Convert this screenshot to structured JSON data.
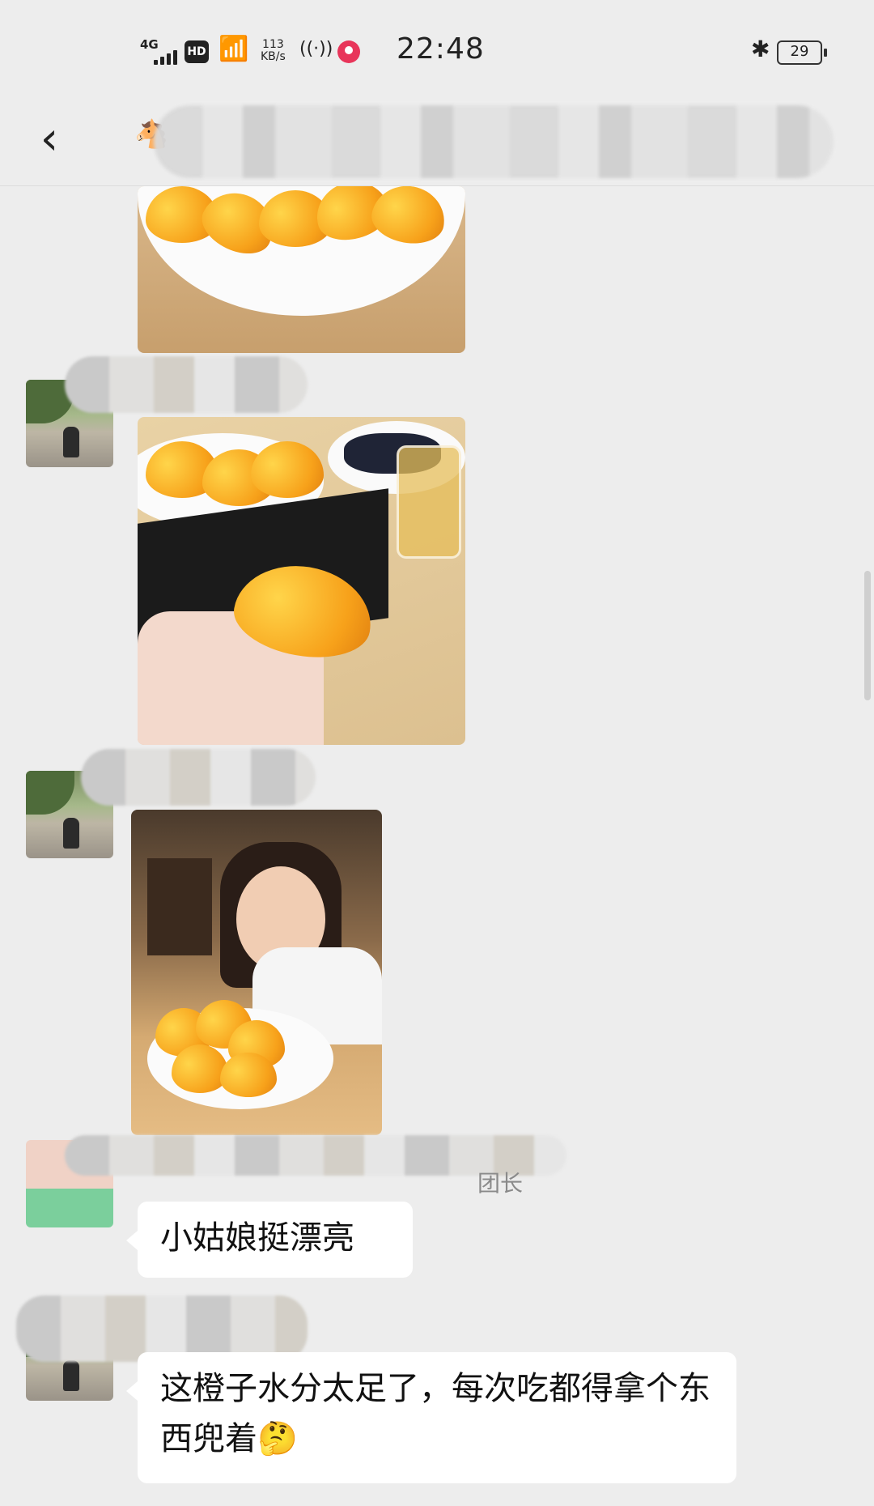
{
  "status_bar": {
    "network": "4G",
    "hd": "HD",
    "speed_value": "113",
    "speed_unit": "KB/s",
    "time": "22:48",
    "battery": "29"
  },
  "nav": {
    "back_icon": "chevron-left-icon",
    "title_emoji": "🐴"
  },
  "messages": [
    {
      "type": "image",
      "content": "orange slices on plate"
    },
    {
      "type": "image",
      "content": "hand holding orange slice"
    },
    {
      "type": "image",
      "content": "girl eating oranges"
    },
    {
      "type": "text",
      "sender_suffix": "团长",
      "text": "小姑娘挺漂亮"
    },
    {
      "type": "text",
      "text": "这橙子水分太足了，每次吃都得拿个东西兜着🤔"
    }
  ]
}
